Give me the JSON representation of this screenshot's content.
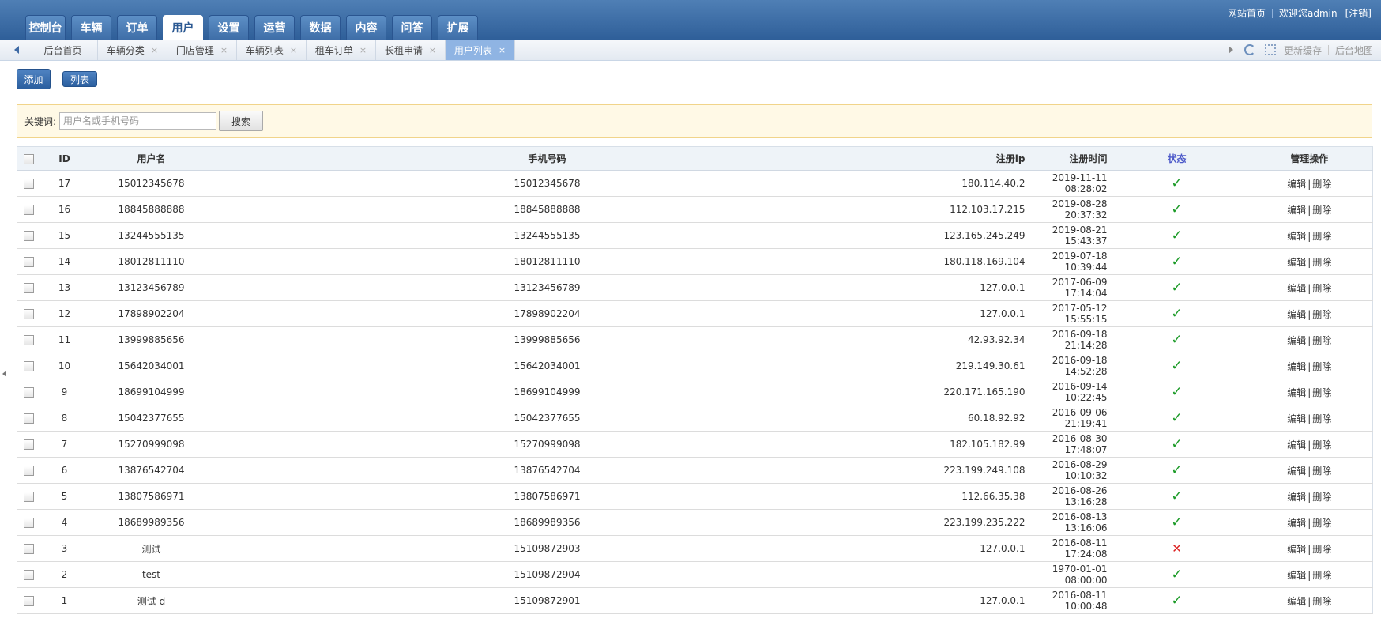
{
  "nav": {
    "tabs": [
      {
        "label": "控制台"
      },
      {
        "label": "车辆"
      },
      {
        "label": "订单"
      },
      {
        "label": "用户"
      },
      {
        "label": "设置"
      },
      {
        "label": "运营"
      },
      {
        "label": "数据"
      },
      {
        "label": "内容"
      },
      {
        "label": "问答"
      },
      {
        "label": "扩展"
      }
    ],
    "active_index": 3
  },
  "topbar": {
    "home_link": "网站首页",
    "welcome": "欢迎您admin",
    "logout": "[注销]"
  },
  "subtabs": {
    "items": [
      {
        "label": "后台首页",
        "closable": false
      },
      {
        "label": "车辆分类",
        "closable": true
      },
      {
        "label": "门店管理",
        "closable": true
      },
      {
        "label": "车辆列表",
        "closable": true
      },
      {
        "label": "租车订单",
        "closable": true
      },
      {
        "label": "长租申请",
        "closable": true
      },
      {
        "label": "用户列表",
        "closable": true
      }
    ],
    "active_index": 6,
    "close_glyph": "×",
    "refresh_cache": "更新缓存",
    "site_map": "后台地图"
  },
  "toolbar": {
    "add_label": "添加",
    "list_label": "列表"
  },
  "search": {
    "label": "关键词:",
    "placeholder": "用户名或手机号码",
    "value": "",
    "button": "搜索"
  },
  "table": {
    "columns": {
      "id": "ID",
      "username": "用户名",
      "phone": "手机号码",
      "ip": "注册ip",
      "time": "注册时间",
      "status": "状态",
      "ops": "管理操作"
    },
    "ok_glyph": "✓",
    "fail_glyph": "✕",
    "op_edit": "编辑",
    "op_sep": "|",
    "op_delete": "删除",
    "rows": [
      {
        "id": "17",
        "username": "15012345678",
        "phone": "15012345678",
        "ip": "180.114.40.2",
        "time": "2019-11-11 08:28:02",
        "status": "ok"
      },
      {
        "id": "16",
        "username": "18845888888",
        "phone": "18845888888",
        "ip": "112.103.17.215",
        "time": "2019-08-28 20:37:32",
        "status": "ok"
      },
      {
        "id": "15",
        "username": "13244555135",
        "phone": "13244555135",
        "ip": "123.165.245.249",
        "time": "2019-08-21 15:43:37",
        "status": "ok"
      },
      {
        "id": "14",
        "username": "18012811110",
        "phone": "18012811110",
        "ip": "180.118.169.104",
        "time": "2019-07-18 10:39:44",
        "status": "ok"
      },
      {
        "id": "13",
        "username": "13123456789",
        "phone": "13123456789",
        "ip": "127.0.0.1",
        "time": "2017-06-09 17:14:04",
        "status": "ok"
      },
      {
        "id": "12",
        "username": "17898902204",
        "phone": "17898902204",
        "ip": "127.0.0.1",
        "time": "2017-05-12 15:55:15",
        "status": "ok"
      },
      {
        "id": "11",
        "username": "13999885656",
        "phone": "13999885656",
        "ip": "42.93.92.34",
        "time": "2016-09-18 21:14:28",
        "status": "ok"
      },
      {
        "id": "10",
        "username": "15642034001",
        "phone": "15642034001",
        "ip": "219.149.30.61",
        "time": "2016-09-18 14:52:28",
        "status": "ok"
      },
      {
        "id": "9",
        "username": "18699104999",
        "phone": "18699104999",
        "ip": "220.171.165.190",
        "time": "2016-09-14 10:22:45",
        "status": "ok"
      },
      {
        "id": "8",
        "username": "15042377655",
        "phone": "15042377655",
        "ip": "60.18.92.92",
        "time": "2016-09-06 21:19:41",
        "status": "ok"
      },
      {
        "id": "7",
        "username": "15270999098",
        "phone": "15270999098",
        "ip": "182.105.182.99",
        "time": "2016-08-30 17:48:07",
        "status": "ok"
      },
      {
        "id": "6",
        "username": "13876542704",
        "phone": "13876542704",
        "ip": "223.199.249.108",
        "time": "2016-08-29 10:10:32",
        "status": "ok"
      },
      {
        "id": "5",
        "username": "13807586971",
        "phone": "13807586971",
        "ip": "112.66.35.38",
        "time": "2016-08-26 13:16:28",
        "status": "ok"
      },
      {
        "id": "4",
        "username": "18689989356",
        "phone": "18689989356",
        "ip": "223.199.235.222",
        "time": "2016-08-13 13:16:06",
        "status": "ok"
      },
      {
        "id": "3",
        "username": "测试",
        "phone": "15109872903",
        "ip": "127.0.0.1",
        "time": "2016-08-11 17:24:08",
        "status": "disabled"
      },
      {
        "id": "2",
        "username": "test",
        "phone": "15109872904",
        "ip": "",
        "time": "1970-01-01 08:00:00",
        "status": "ok"
      },
      {
        "id": "1",
        "username": "测试 d",
        "phone": "15109872901",
        "ip": "127.0.0.1",
        "time": "2016-08-11 10:00:48",
        "status": "ok"
      }
    ]
  }
}
